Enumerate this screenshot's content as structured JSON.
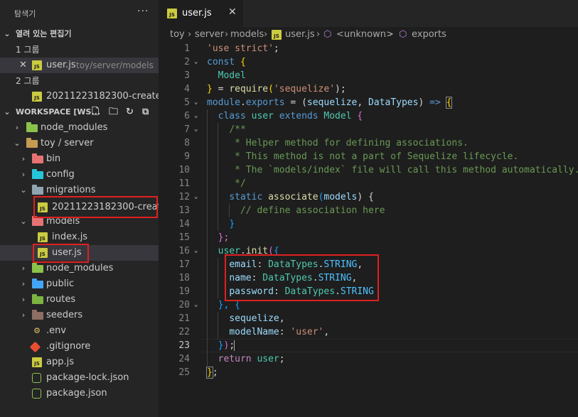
{
  "sidebar": {
    "title": "탐색기",
    "more": "···",
    "open_editors": {
      "header": "열려 있는 편집기",
      "groups": [
        {
          "label": "1 그룹",
          "file": "user.js",
          "path": "toy/server/models",
          "close": "✕"
        },
        {
          "label": "2 그룹",
          "file": "20211223182300-create-..."
        }
      ]
    },
    "workspace": {
      "header": "WORKSPACE [WS...",
      "tree": [
        {
          "name": "node_modules"
        },
        {
          "name": "toy / server"
        },
        {
          "name": "bin"
        },
        {
          "name": "config"
        },
        {
          "name": "migrations"
        },
        {
          "name": "20211223182300-create..."
        },
        {
          "name": "models"
        },
        {
          "name": "index.js"
        },
        {
          "name": "user.js"
        },
        {
          "name": "node_modules"
        },
        {
          "name": "public"
        },
        {
          "name": "routes"
        },
        {
          "name": "seeders"
        },
        {
          "name": ".env"
        },
        {
          "name": ".gitignore"
        },
        {
          "name": "app.js"
        },
        {
          "name": "package-lock.json"
        },
        {
          "name": "package.json"
        }
      ]
    }
  },
  "editor": {
    "tab": {
      "label": "user.js",
      "close": "✕"
    },
    "breadcrumb": [
      "toy",
      "server",
      "models",
      "user.js",
      "<unknown>",
      "exports"
    ],
    "current_line": 23,
    "code": {
      "l1": [
        "'use strict'",
        ";"
      ],
      "l2": [
        "const",
        "{"
      ],
      "l3": [
        "Model"
      ],
      "l4": [
        "}",
        " = ",
        "require",
        "(",
        "'sequelize'",
        ");"
      ],
      "l5": [
        "module",
        ".",
        "exports",
        " = (",
        "sequelize",
        ", ",
        "DataTypes",
        ") ",
        "=>",
        " ",
        "{"
      ],
      "l6": [
        "class",
        "user",
        "extends",
        "Model",
        "{"
      ],
      "l7": "/**",
      "l8": " * Helper method for defining associations.",
      "l9": " * This method is not a part of Sequelize lifecycle.",
      "l10": " * The `models/index` file will call this method automatically.",
      "l11": " */",
      "l12": [
        "static",
        "associate",
        "(",
        "models",
        ") {"
      ],
      "l13": "// define association here",
      "l14": "}",
      "l15": "};",
      "l16": [
        "user",
        ".",
        "init",
        "(",
        "{"
      ],
      "l17": [
        "email",
        ": ",
        "DataTypes",
        ".",
        "STRING",
        ","
      ],
      "l18": [
        "name",
        ": ",
        "DataTypes",
        ".",
        "STRING",
        ","
      ],
      "l19": [
        "password",
        ": ",
        "DataTypes",
        ".",
        "STRING"
      ],
      "l20": [
        "}",
        ", {"
      ],
      "l21": [
        "sequelize",
        ","
      ],
      "l22": [
        "modelName",
        ": ",
        "'user'",
        ","
      ],
      "l23": [
        "}",
        ")",
        ";"
      ],
      "l24": [
        "return",
        "user",
        ";"
      ],
      "l25": [
        "}",
        ";"
      ]
    }
  },
  "colors": {
    "sidebar_bg": "#252526",
    "editor_bg": "#1e1e1e",
    "highlight_box": "#e02020",
    "keyword": "#569cd6",
    "string": "#ce9178",
    "comment": "#6a9955",
    "type": "#4ec9b0"
  }
}
